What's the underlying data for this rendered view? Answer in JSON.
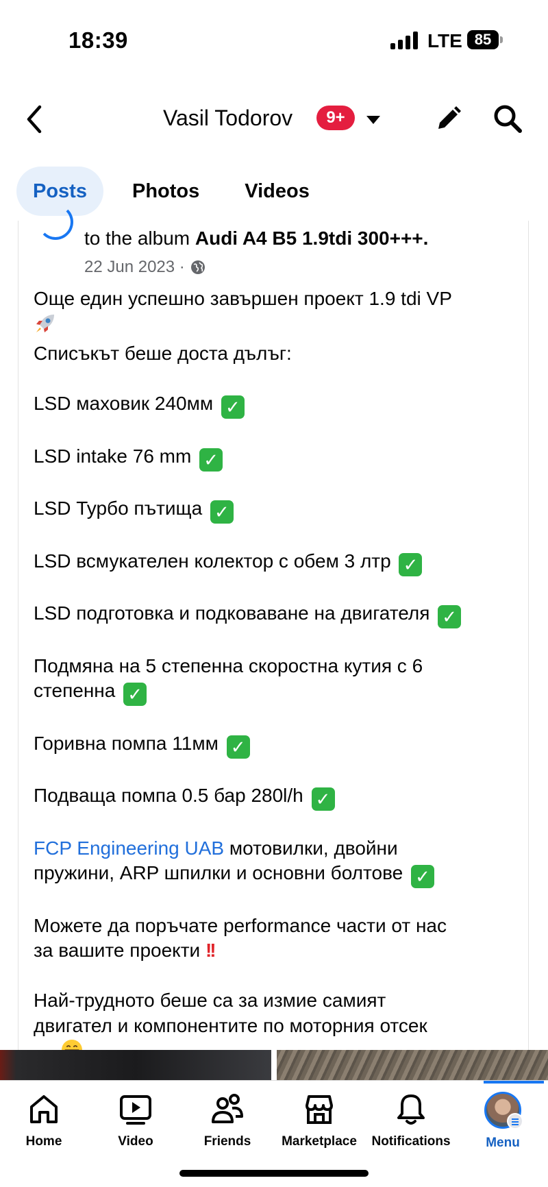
{
  "status_bar": {
    "time": "18:39",
    "network": "LTE",
    "battery": "85"
  },
  "header": {
    "title": "Vasil Todorov",
    "badge": "9+"
  },
  "tabs": [
    {
      "label": "Posts",
      "active": true
    },
    {
      "label": "Photos",
      "active": false
    },
    {
      "label": "Videos",
      "active": false
    }
  ],
  "post": {
    "album_prefix": "to the album ",
    "album_name": "Audi A4 B5 1.9tdi 300+++.",
    "date": "22 Jun 2023 ·",
    "line1": "Още един успешно завършен проект 1.9 tdi VP",
    "line2": "Списъкът беше доста дълъг:",
    "items": [
      "LSD маховик 240мм",
      "LSD intake 76 mm",
      "LSD Турбо пътища",
      "LSD всмукателен колектор с обем 3 лтр",
      "LSD подготовка и подковаване на двигателя"
    ],
    "gearbox_line1": "Подмяна на 5 степенна скоростна кутия с 6",
    "gearbox_line2": "степенна",
    "fuel_pump": "Горивна помпа 11мм",
    "lift_pump": "Подваща помпа 0.5 бар 280l/h",
    "fcp_link": "FCP Engineering UAB",
    "fcp_rest": " мотовилки, двойни",
    "fcp_line2": "пружини, ARP шпилки и основни болтове",
    "order_line1": "Можете да поръчате performance части от нас",
    "order_line2": "за вашите проекти",
    "hard_line1": "Най-трудното беше са за измие самият",
    "hard_line2": "двигател и компонентите по моторния отсек",
    "hard_line3": "....."
  },
  "nav": [
    {
      "label": "Home",
      "icon": "home-icon"
    },
    {
      "label": "Video",
      "icon": "video-icon"
    },
    {
      "label": "Friends",
      "icon": "friends-icon"
    },
    {
      "label": "Marketplace",
      "icon": "marketplace-icon"
    },
    {
      "label": "Notifications",
      "icon": "bell-icon"
    },
    {
      "label": "Menu",
      "icon": "profile-avatar",
      "active": true
    }
  ],
  "colors": {
    "accent": "#1877f2",
    "badge": "#e41e3f",
    "link": "#216fdb",
    "check": "#2fb344"
  }
}
